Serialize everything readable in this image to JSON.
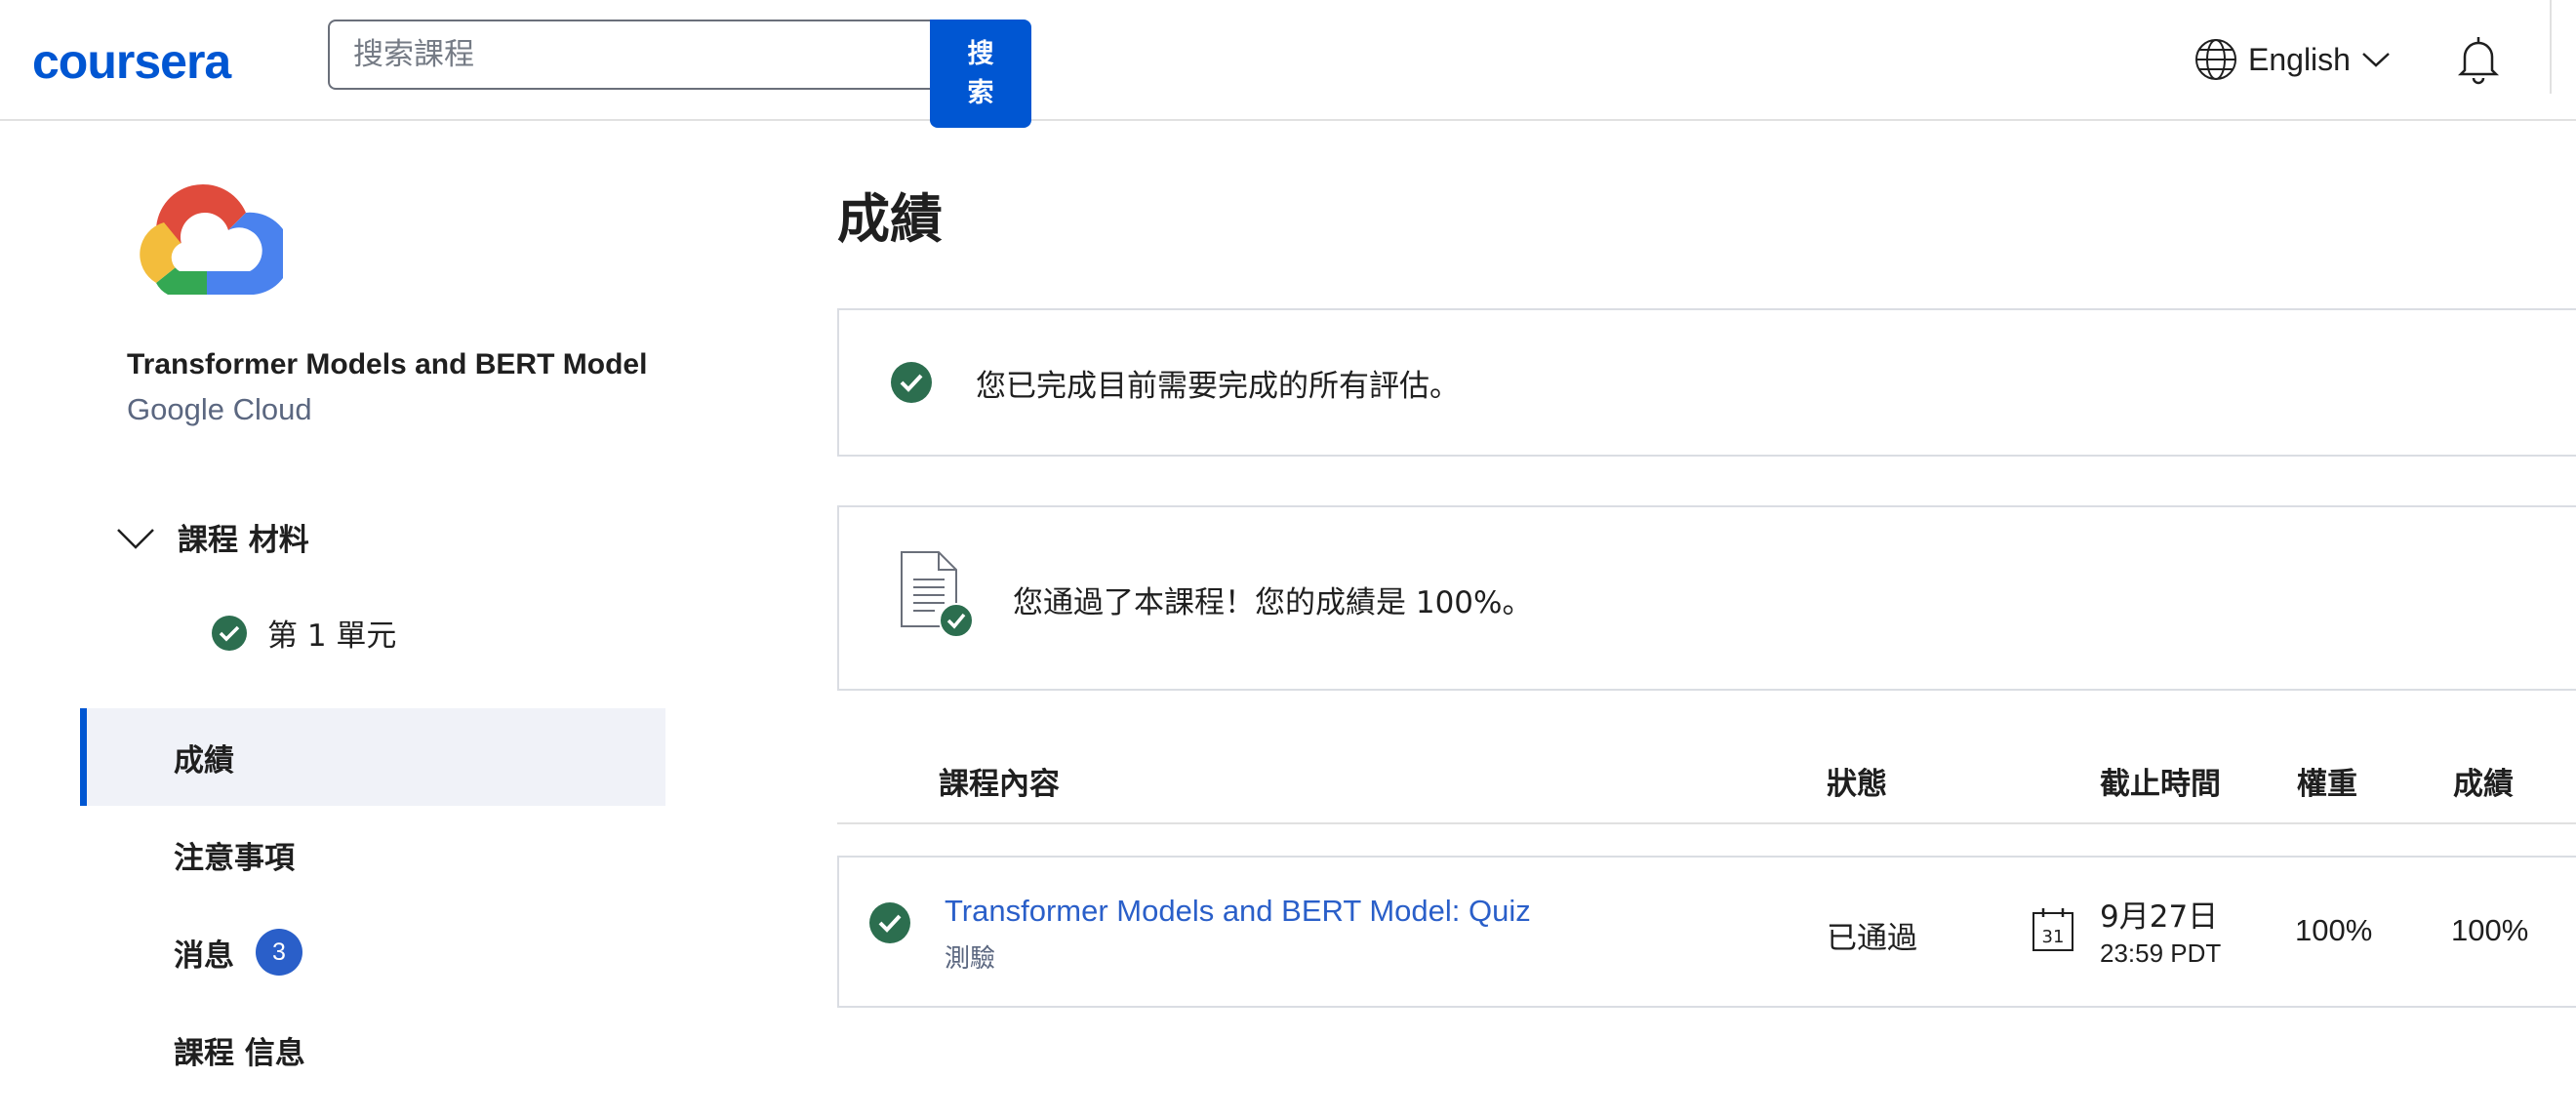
{
  "header": {
    "logo_text": "coursera",
    "search_placeholder": "搜索課程",
    "search_button": "搜索",
    "language": "English"
  },
  "sidebar": {
    "course_title": "Transformer Models and BERT Model",
    "course_partner": "Google Cloud",
    "materials_label": "課程 材料",
    "module_label": "第 1 單元",
    "nav": [
      {
        "label": "成績",
        "active": true
      },
      {
        "label": "注意事項"
      },
      {
        "label": "消息",
        "badge": "3"
      },
      {
        "label": "課程 信息"
      }
    ]
  },
  "main": {
    "title": "成績",
    "completion_message": "您已完成目前需要完成的所有評估。",
    "pass_message": "您通過了本課程！您的成績是 100%。",
    "table": {
      "headers": [
        "課程內容",
        "狀態",
        "截止時間",
        "權重",
        "成績"
      ],
      "rows": [
        {
          "name": "Transformer Models and BERT Model: Quiz",
          "type": "測驗",
          "status": "已通過",
          "due_date": "9月27日",
          "due_time": "23:59 PDT",
          "calendar_day": "31",
          "weight": "100%",
          "grade": "100%"
        }
      ]
    }
  },
  "colors": {
    "brand": "#0056d2",
    "link": "#2a5fc9",
    "success": "#2c6e4f",
    "badge": "#2a5fc9"
  },
  "icons": [
    "globe-icon",
    "chevron-down-icon",
    "bell-icon",
    "google-cloud-logo",
    "check-circle-icon",
    "document-check-icon",
    "calendar-icon"
  ]
}
